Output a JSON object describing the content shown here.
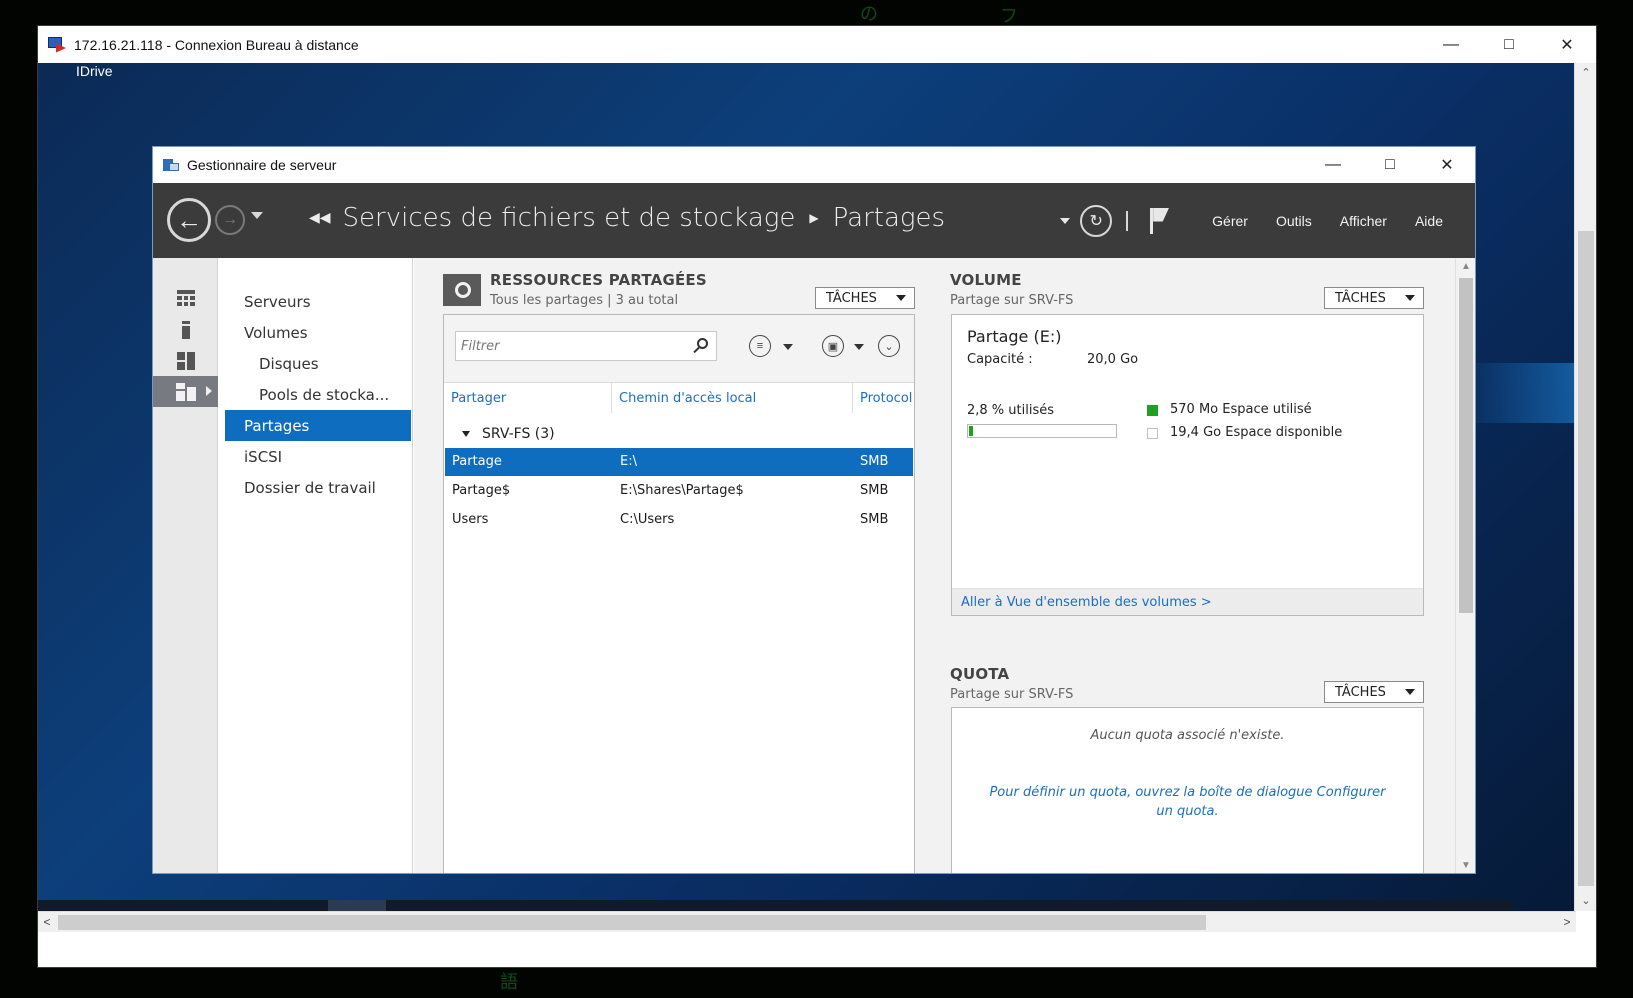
{
  "rdp": {
    "title": "172.16.21.118 - Connexion Bureau à distance"
  },
  "desktop": {
    "shortcut_label": "IDrive"
  },
  "server_manager": {
    "title": "Gestionnaire de serveur",
    "breadcrumb": {
      "root": "Services de fichiers et de stockage",
      "current": "Partages"
    },
    "menu": {
      "manage": "Gérer",
      "tools": "Outils",
      "view": "Afficher",
      "help": "Aide"
    },
    "nav": {
      "items": [
        {
          "label": "Serveurs"
        },
        {
          "label": "Volumes"
        },
        {
          "label": "Disques"
        },
        {
          "label": "Pools de stocka..."
        },
        {
          "label": "Partages"
        },
        {
          "label": "iSCSI"
        },
        {
          "label": "Dossier de travail"
        }
      ]
    }
  },
  "shares": {
    "title": "RESSOURCES PARTAGÉES",
    "subtitle": "Tous les partages | 3 au total",
    "tasks_label": "TÂCHES",
    "filter_placeholder": "Filtrer",
    "columns": {
      "share": "Partager",
      "path": "Chemin d'accès local",
      "protocol": "Protocol"
    },
    "group": "SRV-FS (3)",
    "rows": [
      {
        "name": "Partage",
        "path": "E:\\",
        "protocol": "SMB"
      },
      {
        "name": "Partage$",
        "path": "E:\\Shares\\Partage$",
        "protocol": "SMB"
      },
      {
        "name": "Users",
        "path": "C:\\Users",
        "protocol": "SMB"
      }
    ]
  },
  "volume": {
    "title": "VOLUME",
    "subtitle": "Partage sur SRV-FS",
    "tasks_label": "TÂCHES",
    "name": "Partage (E:)",
    "capacity_label": "Capacité :",
    "capacity_value": "20,0 Go",
    "used_pct_label": "2,8 % utilisés",
    "used_fraction": 0.028,
    "used_legend": "570 Mo Espace utilisé",
    "free_legend": "19,4 Go Espace disponible",
    "used_color": "#1fa020",
    "link": "Aller à Vue d'ensemble des volumes >"
  },
  "quota": {
    "title": "QUOTA",
    "subtitle": "Partage sur SRV-FS",
    "tasks_label": "TÂCHES",
    "empty_message": "Aucun quota associé n'existe.",
    "hint": "Pour définir un quota, ouvrez la boîte de dialogue Configurer un quota."
  },
  "colors": {
    "accent": "#0f6dc0",
    "header_bg": "#3b3b3b"
  }
}
